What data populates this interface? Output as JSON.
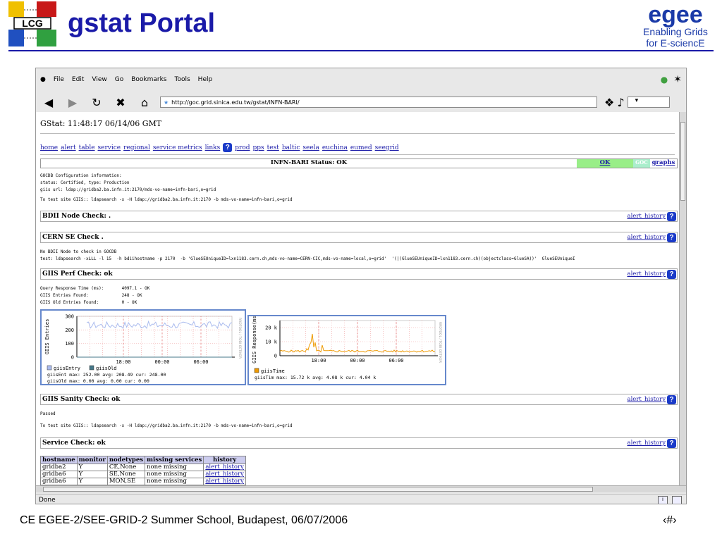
{
  "slide": {
    "title": "gstat Portal",
    "lcg_text": "LCG",
    "egee_logo": "egee",
    "egee_line1": "Enabling Grids",
    "egee_line2": "for E-sciencE",
    "footer": "CE EGEE-2/SEE-GRID-2 Summer School, Budapest, 06/07/2006",
    "page_number": "‹#›"
  },
  "browser": {
    "menu": [
      "File",
      "Edit",
      "View",
      "Go",
      "Bookmarks",
      "Tools",
      "Help"
    ],
    "url": "http://goc.grid.sinica.edu.tw/gstat/INFN-BARI/",
    "status": "Done"
  },
  "page": {
    "gstat_time": "GStat: 11:48:17 06/14/06 GMT",
    "nav_links": [
      "home",
      "alert",
      "table",
      "service",
      "regional",
      "service metrics",
      "links",
      "prod",
      "pps",
      "test",
      "baltic",
      "seela",
      "euchina",
      "eumed",
      "seegrid"
    ],
    "help": "?",
    "status_label": "INFN-BARI Status: OK",
    "status_ok": "OK",
    "goc_label": "GOC",
    "graphs_label": "graphs",
    "goc_info": "GOCDB Configuration information:\nstatus: Certified, type: Production\ngiis url: ldap://gridba2.ba.infn.it:2170/mds-vo-name=infn-bari,o=grid",
    "test_site": "To test site GIIS:: ldapsearch -x -H ldap://gridba2.ba.infn.it:2170 -b mds-vo-name=infn-bari,o=grid",
    "bdii_title": "BDII Node Check: .",
    "cern_title": "CERN SE Check .",
    "cern_info": "No BDII Node to check in GOCDB\ntest: ldapsearch -xLLL -l 15  -h bdiihostname -p 2170  -b 'GlueSEUniqueID=lxn1183.cern.ch,mds-vo-name=CERN-CIC,mds-vo-name=local,o=grid'  '(|(GlueSEUniqueID=lxn1183.cern.ch)(objectclass=GlueSA))'  GlueSEUniqueI",
    "perf_title": "GIIS Perf Check: ok",
    "perf_info": "Query Response Time (ms):       4097.1 - OK\nGIIS Entries Found:             248 - OK\nGIIS Old Entries Found:         0 - OK",
    "sanity_title": "GIIS Sanity Check: ok",
    "sanity_info": "Passed",
    "test_site2": "To test site GIIS:: ldapsearch -x -H ldap://gridba2.ba.infn.it:2170 -b mds-vo-name=infn-bari,o=grid",
    "service_title": "Service Check: ok",
    "alert_history": "alert_history",
    "table": {
      "headers": [
        "hostname",
        "monitor",
        "nodetypes",
        "missing services",
        "history"
      ],
      "rows": [
        [
          "gridba2",
          "Y",
          "CE,None",
          "none missing",
          "alert_history"
        ],
        [
          "gridba6",
          "Y",
          "SE,None",
          "none missing",
          "alert_history"
        ],
        [
          "gridba6",
          "Y",
          "MON,SE",
          "none missing",
          "alert_history"
        ]
      ]
    }
  },
  "chart_data": [
    {
      "type": "line",
      "ylabel": "GIIS Entries",
      "ylim": [
        0,
        300
      ],
      "yticks": [
        "300",
        "200",
        "100",
        "0"
      ],
      "xticks": [
        "18:00",
        "00:00",
        "06:00"
      ],
      "side_label": "RRDTOOL / TOBI OETIKER",
      "series": [
        {
          "name": "giisEntry",
          "color": "#aabbee"
        },
        {
          "name": "giisOld",
          "color": "#447788"
        }
      ],
      "stats": [
        "giisEnt max:  252.00     avg:  208.49     cur:  248.00",
        "giisOld max:    0.00     avg:    0.00     cur:    0.00"
      ]
    },
    {
      "type": "line",
      "ylabel": "GIIS Response(ms)",
      "ylim": [
        0,
        25000
      ],
      "yticks": [
        "20 k",
        "10 k",
        "0"
      ],
      "xticks": [
        "18:00",
        "00:00",
        "06:00"
      ],
      "side_label": "RRDTOOL / TOBI OETIKER",
      "series": [
        {
          "name": "giisTime",
          "color": "#ee9900"
        }
      ],
      "stats": [
        "giisTim max:   15.72 k    avg:    4.08 k    cur:    4.04 k"
      ]
    }
  ]
}
